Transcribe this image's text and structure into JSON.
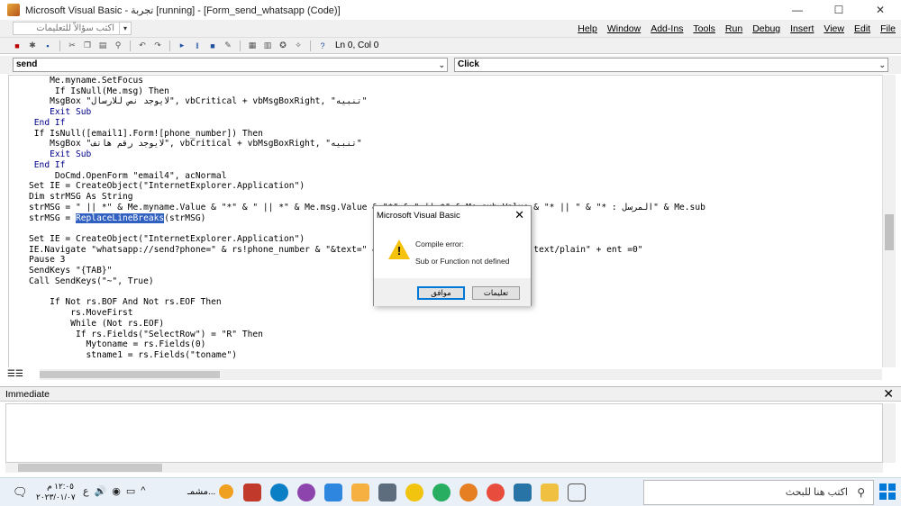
{
  "window": {
    "title": "Microsoft Visual Basic - تجربة [running] - [Form_send_whatsapp (Code)]",
    "min": "—",
    "max": "☐",
    "close": "✕"
  },
  "menubar": {
    "ask_placeholder": "اكتب سؤالاً للتعليمات",
    "ask_arrow": "▾",
    "items": [
      "Help",
      "Window",
      "Add-Ins",
      "Tools",
      "Run",
      "Debug",
      "Insert",
      "View",
      "Edit",
      "File"
    ]
  },
  "toolbar": {
    "position": "Ln 0, Col 0"
  },
  "combos": {
    "object": "send",
    "procedure": "Click",
    "arrow": "⌄"
  },
  "code_lines": [
    "    Me.myname.SetFocus",
    "     If IsNull(Me.msg) Then",
    "    MsgBox \"لايوجد نص للارسال\", vbCritical + vbMsgBoxRight, \"تنبيه\"",
    "    Exit Sub",
    " End If",
    " If IsNull([email1].Form![phone_number]) Then",
    "    MsgBox \"لايوجد رقم هاتف\", vbCritical + vbMsgBoxRight, \"تنبيه\"",
    "    Exit Sub",
    " End If",
    "     DoCmd.OpenForm \"email4\", acNormal",
    "Set IE = CreateObject(\"InternetExplorer.Application\")",
    "Dim strMSG As String",
    "strMSG = \" || *\" & Me.myname.Value & \"*\" & \" || *\" & Me.msg.Value & \"*\" & \" || *\" & Me.sub.Value & \"* || \" & \"* : المرسل\" & Me.sub",
    "strMSG = ReplaceLineBreaks(strMSG)",
    "",
    "Set IE = CreateObject(\"InternetExplorer.Application\")",
    "IE.Navigate \"whatsapp://send?phone=\" & rs!phone_number & \"&text=\" & strMSG, , , , \"Content-Type: text/plain\" + ent =0\"",
    "Pause 3",
    "SendKeys \"{TAB}\"",
    "Call SendKeys(\"~\", True)",
    "",
    "    If Not rs.BOF And Not rs.EOF Then",
    "        rs.MoveFirst",
    "        While (Not rs.EOF)",
    "         If rs.Fields(\"SelectRow\") = \"R\" Then",
    "           Mytoname = rs.Fields(0)",
    "           stname1 = rs.Fields(\"toname\")"
  ],
  "immediate": {
    "label": "Immediate",
    "close": "✕"
  },
  "dialog": {
    "title": "Microsoft Visual Basic",
    "close": "✕",
    "line1": "Compile error:",
    "line2": "Sub or Function not defined",
    "ok": "موافق",
    "help": "تعليمات",
    "icon": "warning-icon"
  },
  "taskbar": {
    "search": "اكتب هنا للبحث",
    "time": "١٢:٠٥ م",
    "date": "٢٠٢٣/٠١/٠٧",
    "weather": "مشمـ...",
    "lang": "ع",
    "notif": "🗨"
  },
  "colors": {
    "keyword": "#00008b",
    "highlight": "#3060c0",
    "accent": "#0078d7"
  }
}
